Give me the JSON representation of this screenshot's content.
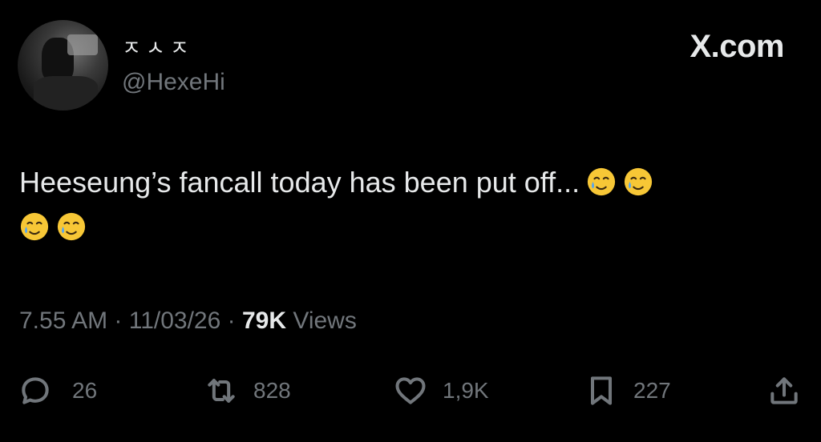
{
  "user": {
    "display_name": "ㅈㅅㅈ",
    "handle": "@HexeHi"
  },
  "brand": "X.com",
  "tweet": {
    "text": "Heeseung’s fancall today has been put off...",
    "emoji_name": "smiling-face-with-tear"
  },
  "meta": {
    "time": "7.55 AM",
    "sep1": " · ",
    "date": "11/03/26",
    "sep2": " · ",
    "views_count": "79K",
    "views_label": " Views"
  },
  "actions": {
    "replies": "26",
    "reposts": "828",
    "likes": "1,9K",
    "bookmarks": "227"
  },
  "colors": {
    "background": "#000000",
    "text_primary": "#e7e9ea",
    "text_secondary": "#71767b"
  }
}
